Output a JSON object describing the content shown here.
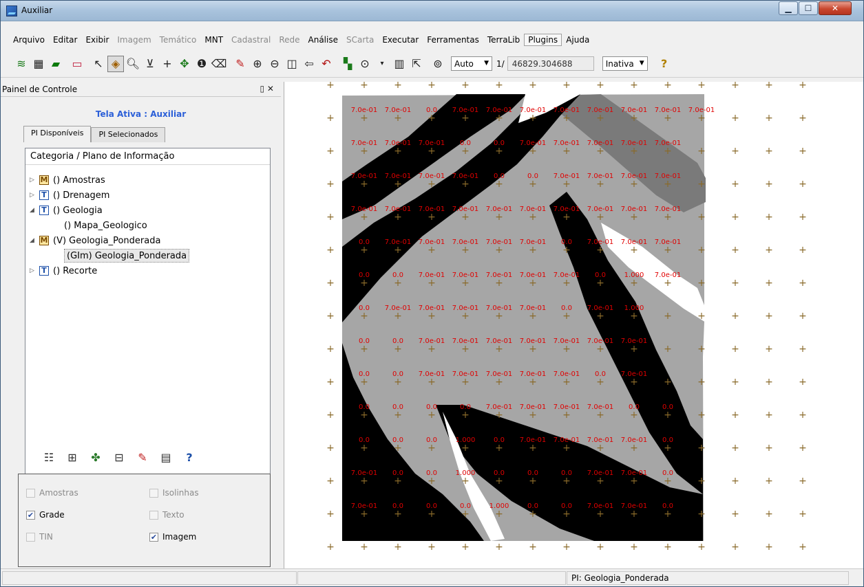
{
  "window": {
    "title": "Auxiliar"
  },
  "menu": [
    {
      "label": "Arquivo",
      "enabled": true
    },
    {
      "label": "Editar",
      "enabled": true
    },
    {
      "label": "Exibir",
      "enabled": true
    },
    {
      "label": "Imagem",
      "enabled": false
    },
    {
      "label": "Temático",
      "enabled": false
    },
    {
      "label": "MNT",
      "enabled": true
    },
    {
      "label": "Cadastral",
      "enabled": false
    },
    {
      "label": "Rede",
      "enabled": false
    },
    {
      "label": "Análise",
      "enabled": true
    },
    {
      "label": "SCarta",
      "enabled": false
    },
    {
      "label": "Executar",
      "enabled": true
    },
    {
      "label": "Ferramentas",
      "enabled": true
    },
    {
      "label": "TerraLib",
      "enabled": true
    },
    {
      "label": "Plugins",
      "enabled": true
    },
    {
      "label": "Ajuda",
      "enabled": true
    }
  ],
  "toolbar": {
    "scale_mode": "Auto",
    "scale_prefix": "1/",
    "scale_value": "46829.304688",
    "status_combo": "Inativa"
  },
  "panel": {
    "title": "Painel de Controle",
    "active_screen": "Tela Ativa : Auxiliar",
    "tabs": [
      "PI Disponíveis",
      "PI Selecionados"
    ],
    "tree_header": "Categoria / Plano de Informação",
    "tree": [
      {
        "badge": "M",
        "label": "() Amostras"
      },
      {
        "badge": "T",
        "label": "() Drenagem"
      },
      {
        "badge": "T",
        "label": "() Geologia"
      },
      {
        "badge": "",
        "label": "() Mapa_Geologico"
      },
      {
        "badge": "M",
        "label": "(V) Geologia_Ponderada"
      },
      {
        "badge": "",
        "label": "(GIm) Geologia_Ponderada"
      },
      {
        "badge": "T",
        "label": "() Recorte"
      }
    ],
    "options": [
      {
        "label": "Amostras",
        "checked": false,
        "enabled": false
      },
      {
        "label": "Isolinhas",
        "checked": false,
        "enabled": false
      },
      {
        "label": "Grade",
        "checked": true,
        "enabled": true
      },
      {
        "label": "Texto",
        "checked": false,
        "enabled": false
      },
      {
        "label": "TIN",
        "checked": false,
        "enabled": false
      },
      {
        "label": "Imagem",
        "checked": true,
        "enabled": true
      }
    ]
  },
  "map": {
    "labels": [
      [
        "7.0e-01",
        "7.0e-01",
        "0.0",
        "7.0e-01",
        "7.0e-01",
        "7.0e-01",
        "7.0e-01",
        "7.0e-01",
        "7.0e-01",
        "7.0e-01",
        "7.0e-01"
      ],
      [
        "7.0e-01",
        "7.0e-01",
        "7.0e-01",
        "0.0",
        "0.0",
        "7.0e-01",
        "7.0e-01",
        "7.0e-01",
        "7.0e-01",
        "7.0e-01",
        ""
      ],
      [
        "7.0e-01",
        "7.0e-01",
        "7.0e-01",
        "7.0e-01",
        "0.0",
        "0.0",
        "7.0e-01",
        "7.0e-01",
        "7.0e-01",
        "7.0e-01",
        ""
      ],
      [
        "7.0e-01",
        "7.0e-01",
        "7.0e-01",
        "7.0e-01",
        "7.0e-01",
        "7.0e-01",
        "7.0e-01",
        "7.0e-01",
        "7.0e-01",
        "7.0e-01",
        ""
      ],
      [
        "0.0",
        "7.0e-01",
        "7.0e-01",
        "7.0e-01",
        "7.0e-01",
        "7.0e-01",
        "0.0",
        "7.0e-01",
        "7.0e-01",
        "7.0e-01",
        ""
      ],
      [
        "0.0",
        "0.0",
        "7.0e-01",
        "7.0e-01",
        "7.0e-01",
        "7.0e-01",
        "7.0e-01",
        "0.0",
        "1.000",
        "7.0e-01",
        ""
      ],
      [
        "0.0",
        "7.0e-01",
        "7.0e-01",
        "7.0e-01",
        "7.0e-01",
        "7.0e-01",
        "0.0",
        "7.0e-01",
        "1.000",
        "",
        ""
      ],
      [
        "0.0",
        "0.0",
        "7.0e-01",
        "7.0e-01",
        "7.0e-01",
        "7.0e-01",
        "7.0e-01",
        "7.0e-01",
        "7.0e-01",
        "",
        ""
      ],
      [
        "0.0",
        "0.0",
        "7.0e-01",
        "7.0e-01",
        "7.0e-01",
        "7.0e-01",
        "7.0e-01",
        "0.0",
        "7.0e-01",
        "",
        ""
      ],
      [
        "0.0",
        "0.0",
        "0.0",
        "0.0",
        "7.0e-01",
        "7.0e-01",
        "7.0e-01",
        "7.0e-01",
        "0.0",
        "0.0",
        ""
      ],
      [
        "0.0",
        "0.0",
        "0.0",
        "1.000",
        "0.0",
        "7.0e-01",
        "7.0e-01",
        "7.0e-01",
        "7.0e-01",
        "0.0",
        ""
      ],
      [
        "7.0e-01",
        "0.0",
        "0.0",
        "1.000",
        "0.0",
        "0.0",
        "0.0",
        "7.0e-01",
        "7.0e-01",
        "0.0",
        ""
      ],
      [
        "7.0e-01",
        "0.0",
        "0.0",
        "0.0",
        "1.000",
        "0.0",
        "0.0",
        "7.0e-01",
        "7.0e-01",
        "0.0",
        ""
      ]
    ],
    "colors": {
      "gray": "#a6a6a6",
      "dark": "#7a7a7a",
      "black": "#000000",
      "white": "#ffffff",
      "label": "#e00000",
      "cross": "#8a6a2a"
    }
  },
  "status": {
    "pi": "PI: Geologia_Ponderada"
  }
}
